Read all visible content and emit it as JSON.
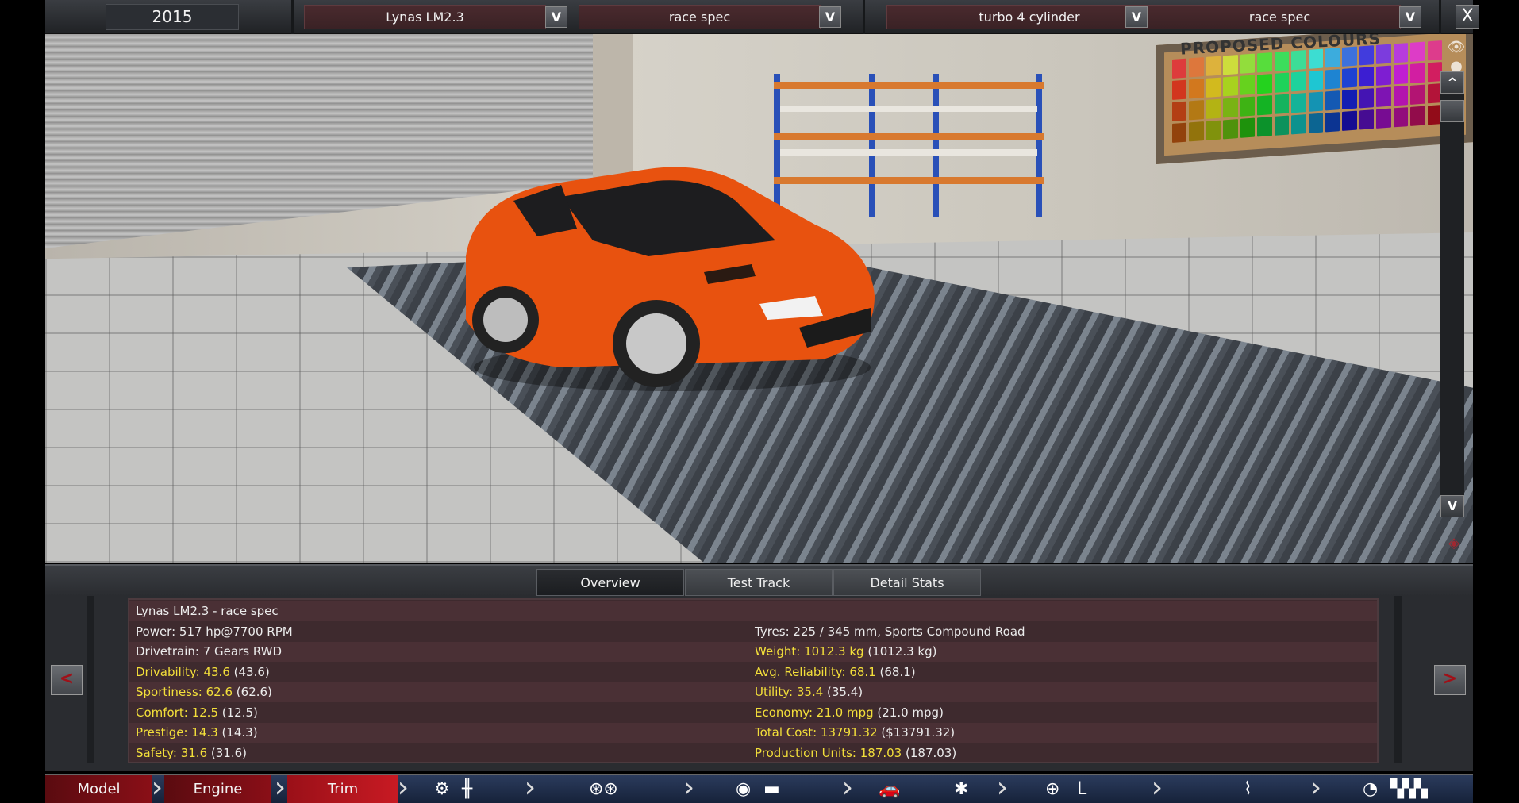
{
  "topbar": {
    "year": "2015",
    "model_select": "Lynas LM2.3",
    "trim_select": "race spec",
    "engine_select": "turbo 4 cylinder",
    "engine_variant_select": "race spec",
    "dropdown_glyph": "V",
    "close_glyph": "X"
  },
  "scene": {
    "board_title": "PROPOSED COLOURS",
    "car_color": "#e8520f",
    "up_glyph": "^",
    "down_glyph": "V"
  },
  "tabs": [
    "Overview",
    "Test Track",
    "Detail Stats"
  ],
  "stats": {
    "left": [
      {
        "label": "Lynas LM2.3 - race spec",
        "extra": ""
      },
      {
        "label": "Power: 517 hp@7700 RPM",
        "extra": ""
      },
      {
        "label": "Drivetrain: 7 Gears RWD",
        "extra": ""
      },
      {
        "label": "Drivability: 43.6",
        "extra": " (43.6)"
      },
      {
        "label": "Sportiness: 62.6",
        "extra": " (62.6)"
      },
      {
        "label": "Comfort: 12.5",
        "extra": " (12.5)"
      },
      {
        "label": "Prestige: 14.3",
        "extra": " (14.3)"
      },
      {
        "label": "Safety: 31.6",
        "extra": " (31.6)"
      }
    ],
    "right": [
      {
        "label": "",
        "extra": ""
      },
      {
        "label": "Tyres: 225 / 345 mm, Sports Compound Road",
        "extra": ""
      },
      {
        "label": "Weight: 1012.3 kg",
        "extra": " (1012.3 kg)"
      },
      {
        "label": "Avg. Reliability: 68.1",
        "extra": " (68.1)"
      },
      {
        "label": "Utility: 35.4",
        "extra": " (35.4)"
      },
      {
        "label": "Economy: 21.0 mpg",
        "extra": " (21.0 mpg)"
      },
      {
        "label": "Total Cost: 13791.32",
        "extra": " ($13791.32)"
      },
      {
        "label": "Production Units: 187.03",
        "extra": " (187.03)"
      }
    ],
    "prev_glyph": "<",
    "next_glyph": ">"
  },
  "nav": {
    "model": "Model",
    "engine": "Engine",
    "trim": "Trim"
  },
  "colors": {
    "yellow_stat": "#f3df3a",
    "panel_bg": "#3e2a2e",
    "nav_active": "#8a0f17"
  }
}
